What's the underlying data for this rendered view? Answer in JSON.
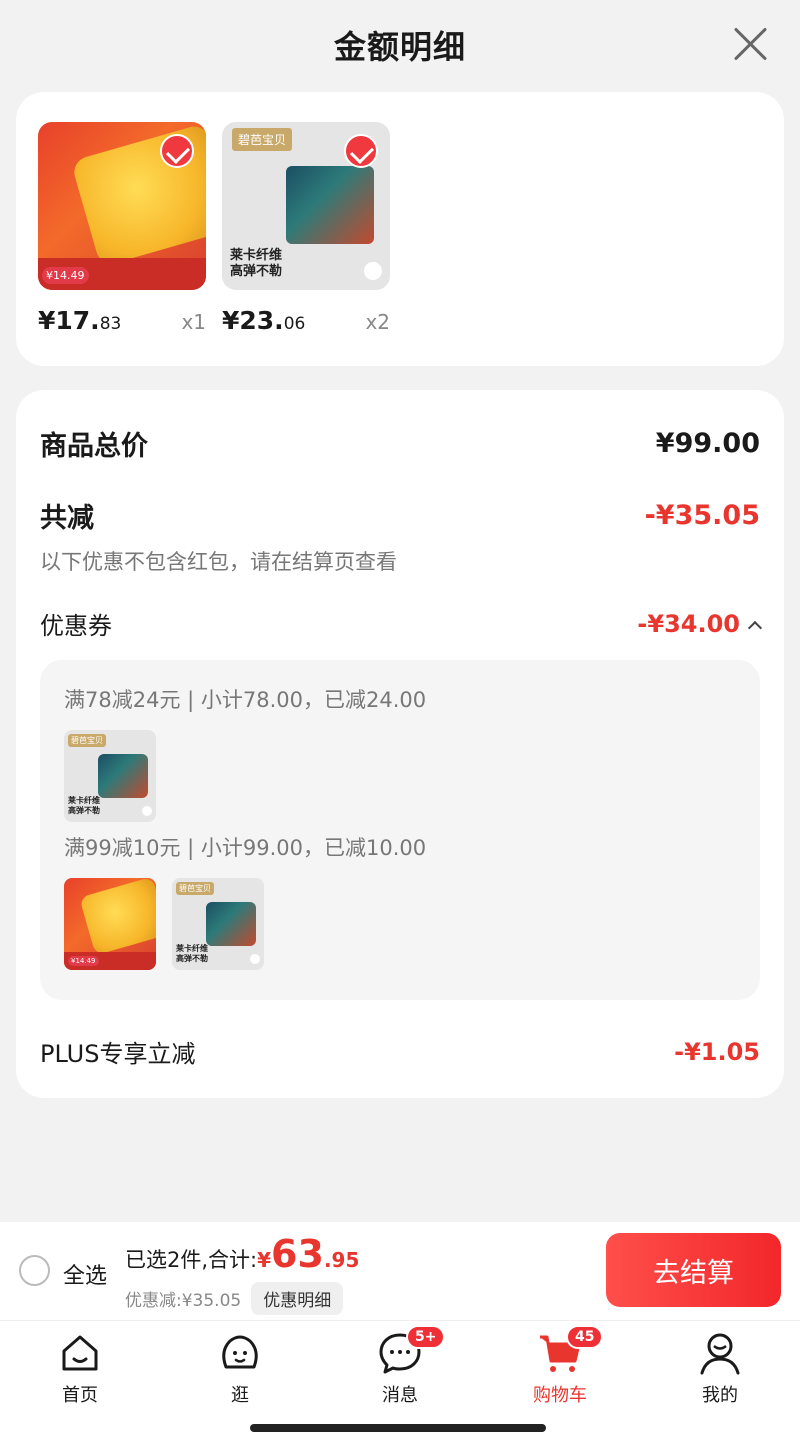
{
  "header": {
    "title": "金额明细"
  },
  "products": [
    {
      "price_int": "¥17.",
      "price_dec": "83",
      "qty": "x1",
      "thumb_tag": "¥14.49"
    },
    {
      "price_int": "¥23.",
      "price_dec": "06",
      "qty": "x2",
      "thumb_logo": "碧芭宝贝",
      "thumb_text1": "莱卡纤维",
      "thumb_text2": "高弹不勒"
    }
  ],
  "summary": {
    "total_label": "商品总价",
    "total_value": "¥99.00",
    "reduce_label": "共减",
    "reduce_value": "-¥35.05",
    "note": "以下优惠不包含红包，请在结算页查看",
    "coupon_label": "优惠券",
    "coupon_value": "-¥34.00",
    "coupon_rules": [
      "满78减24元 | 小计78.00，已减24.00",
      "满99减10元 | 小计99.00，已减10.00"
    ],
    "plus_label": "PLUS专享立减",
    "plus_value": "-¥1.05"
  },
  "checkout": {
    "select_all": "全选",
    "selected_text": "已选2件,合计:",
    "yen": "¥",
    "total_int": "63",
    "total_dec": ".95",
    "discount_text": "优惠减:¥35.05",
    "detail_chip": "优惠明细",
    "button": "去结算"
  },
  "tabs": [
    {
      "label": "首页",
      "icon": "home-icon"
    },
    {
      "label": "逛",
      "icon": "face-icon"
    },
    {
      "label": "消息",
      "icon": "message-icon",
      "badge": "5+"
    },
    {
      "label": "购物车",
      "icon": "cart-icon",
      "badge": "45",
      "active": true
    },
    {
      "label": "我的",
      "icon": "user-icon"
    }
  ],
  "colors": {
    "accent": "#e8362f"
  }
}
